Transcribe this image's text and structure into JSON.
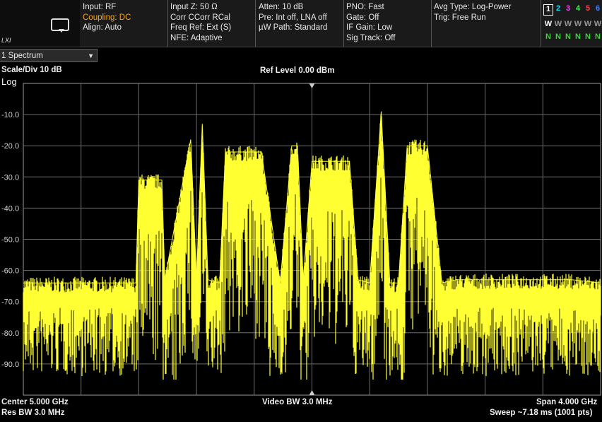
{
  "header": {
    "logo_mark": "LXI",
    "col1": [
      "Input: RF",
      "Coupling: DC",
      "Align: Auto"
    ],
    "col2": [
      "Input Z: 50 Ω",
      "Corr CCorr RCal",
      "Freq Ref: Ext (S)",
      "NFE: Adaptive"
    ],
    "col3": [
      "Atten: 10 dB",
      "Pre: Int off, LNA off",
      "µW Path: Standard"
    ],
    "col4": [
      "PNO: Fast",
      "Gate: Off",
      "IF Gain: Low",
      "Sig Track: Off"
    ],
    "col5": [
      "Avg Type: Log-Power",
      "Trig: Free Run"
    ],
    "traces": {
      "numbers": [
        "1",
        "2",
        "3",
        "4",
        "5",
        "6"
      ],
      "number_colors": [
        "#ffff00",
        "#00e5ff",
        "#ff40ff",
        "#40ff40",
        "#ff4040",
        "#4080ff"
      ],
      "types": [
        "W",
        "W",
        "W",
        "W",
        "W",
        "W"
      ],
      "detectors": [
        "N",
        "N",
        "N",
        "N",
        "N",
        "N"
      ]
    }
  },
  "window_tab": {
    "label": "1 Spectrum",
    "arrow": "▼"
  },
  "labels": {
    "scale_div": "Scale/Div 10 dB",
    "log": "Log",
    "ref_level": "Ref Level 0.00 dBm",
    "center": "Center 5.000 GHz",
    "res_bw": "Res BW 3.0 MHz",
    "video_bw": "Video BW 3.0 MHz",
    "span": "Span 4.000 GHz",
    "sweep": "Sweep ~7.18 ms (1001 pts)"
  },
  "chart_data": {
    "type": "line",
    "title": "",
    "xlabel": "",
    "ylabel": "",
    "units": "dBm",
    "ylim": [
      -100,
      0
    ],
    "xlim": [
      3.0,
      7.0
    ],
    "x_unit": "GHz",
    "ytick_labels": [
      "-10.0",
      "-20.0",
      "-30.0",
      "-40.0",
      "-50.0",
      "-60.0",
      "-70.0",
      "-80.0",
      "-90.0"
    ],
    "ytick_values": [
      -10,
      -20,
      -30,
      -40,
      -50,
      -60,
      -70,
      -80,
      -90
    ],
    "grid": true,
    "trace_color": "#ffff33",
    "series": [
      {
        "x": [
          3.0,
          3.3,
          3.6,
          3.78,
          3.8,
          3.88,
          3.96,
          3.98,
          4.16,
          4.2,
          4.24,
          4.28,
          4.36,
          4.4,
          4.44,
          4.48,
          4.56,
          4.65,
          4.78,
          4.86,
          4.9,
          4.94,
          5.0,
          5.1,
          5.16,
          5.2,
          5.26,
          5.32,
          5.4,
          5.48,
          5.54,
          5.6,
          5.66,
          5.72,
          5.8,
          5.9,
          6.0,
          6.04,
          6.08,
          6.16,
          6.25,
          6.4,
          6.6,
          6.8,
          7.0
        ],
        "y": [
          -64,
          -64,
          -64,
          -64,
          -31,
          -31,
          -31,
          -63,
          -18,
          -63,
          -13,
          -63,
          -64,
          -22,
          -22,
          -22,
          -22,
          -22,
          -64,
          -20,
          -20,
          -63,
          -25,
          -25,
          -25,
          -25,
          -25,
          -63,
          -64,
          -9,
          -64,
          -64,
          -20,
          -20,
          -20,
          -64,
          -63,
          -63,
          -63,
          -63,
          -63,
          -63,
          -63,
          -63,
          -64
        ]
      }
    ]
  }
}
